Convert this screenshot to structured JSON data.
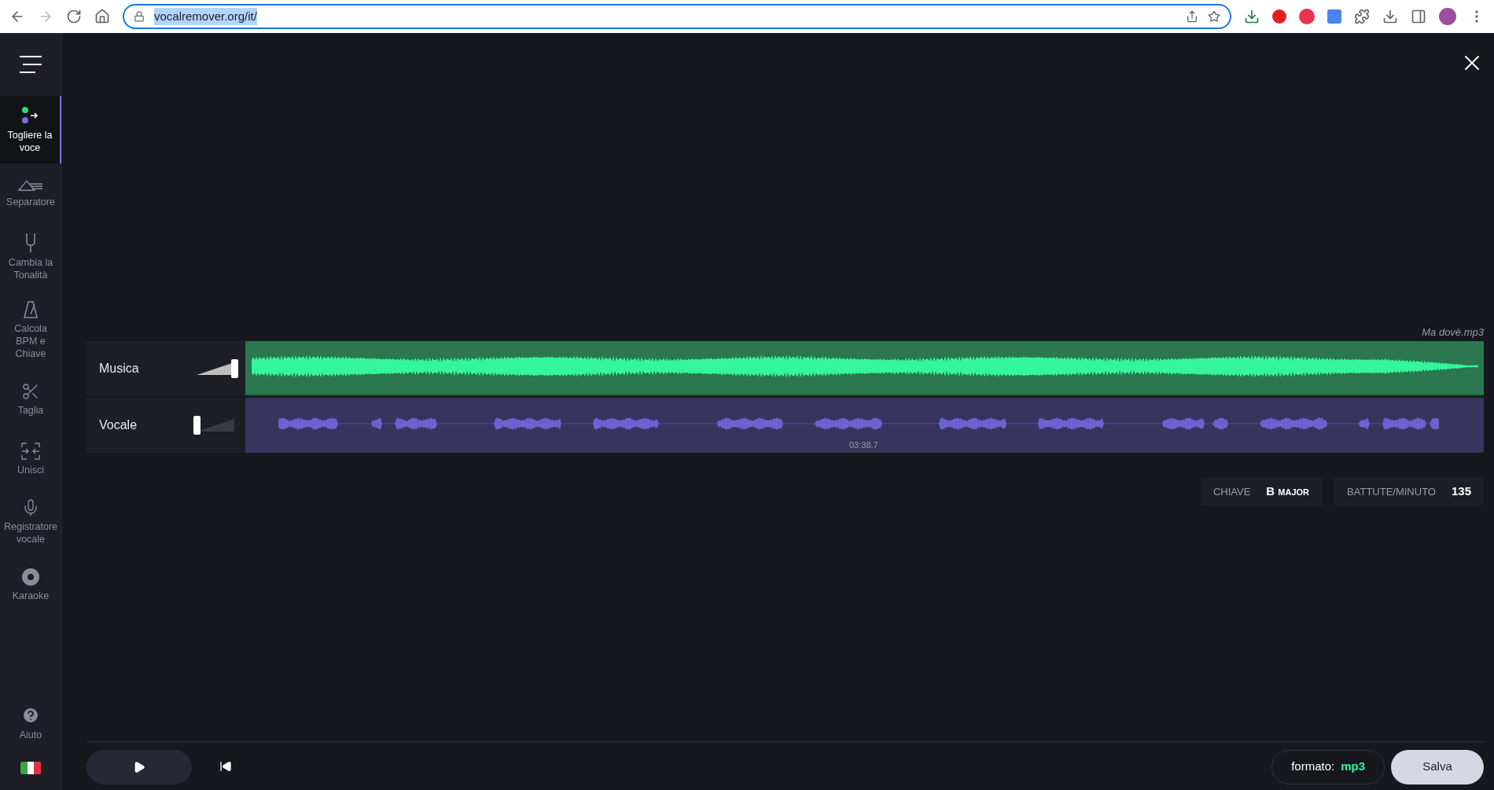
{
  "browser": {
    "url": "vocalremover.org/it/"
  },
  "sidebar": {
    "items": [
      {
        "kind": "remove",
        "label": "Togliere la voce",
        "selected": true
      },
      {
        "kind": "prism",
        "label": "Separatore",
        "selected": false
      },
      {
        "kind": "fork",
        "label": "Cambia la Tonalità",
        "selected": false
      },
      {
        "kind": "metronome",
        "label": "Calcola BPM e Chiave",
        "selected": false
      },
      {
        "kind": "scissors",
        "label": "Taglia",
        "selected": false
      },
      {
        "kind": "join",
        "label": "Unisci",
        "selected": false
      },
      {
        "kind": "mic",
        "label": "Registratore vocale",
        "selected": false
      },
      {
        "kind": "disc",
        "label": "Karaoke",
        "selected": false
      }
    ],
    "help": {
      "label": "Aiuto"
    }
  },
  "file_name": "Ma dovè.mp3",
  "tracks": [
    {
      "kind": "music",
      "name": "Musica",
      "level": 1
    },
    {
      "kind": "vocal",
      "name": "Vocale",
      "level": 0
    }
  ],
  "duration": "03:38.7",
  "key": {
    "label": "CHIAVE",
    "note": "B",
    "mode": "MAJOR"
  },
  "bpm": {
    "label": "BATTUTE/MINUTO",
    "value": "135"
  },
  "footer": {
    "format_label": "formato:",
    "format_value": "mp3",
    "save": "Salva"
  }
}
